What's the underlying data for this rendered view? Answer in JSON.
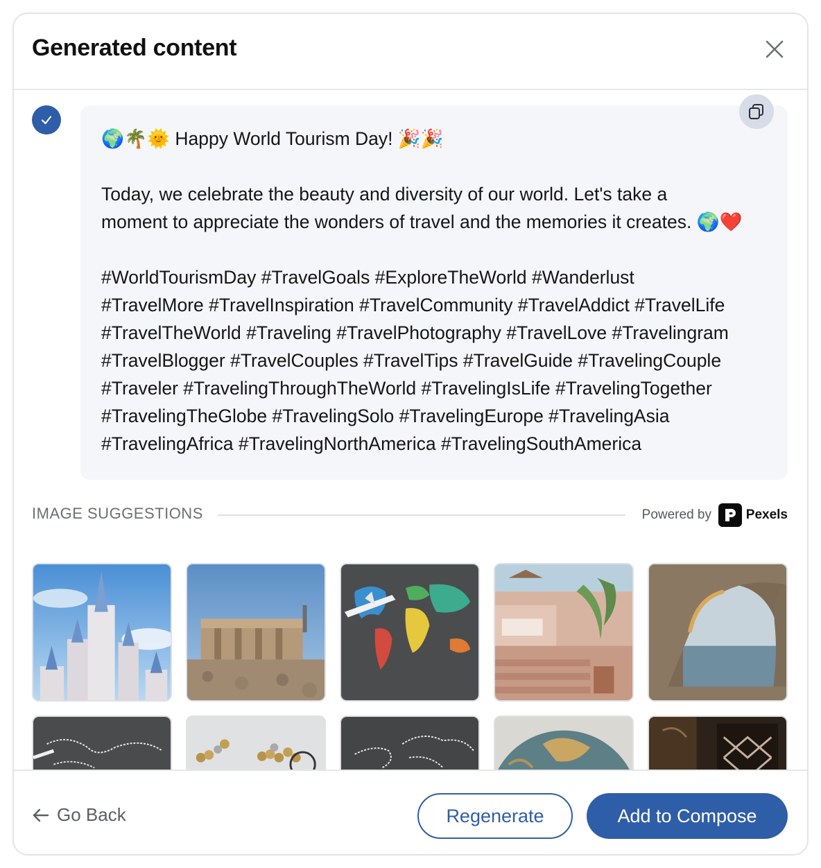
{
  "dialog": {
    "title": "Generated content",
    "close_icon": "close-icon"
  },
  "generated": {
    "selected": true,
    "text": "🌍🌴🌞 Happy World Tourism Day! 🎉🎉\n\nToday, we celebrate the beauty and diversity of our world. Let's take a\nmoment to appreciate the wonders of travel and the memories it creates. 🌍❤️\n\n#WorldTourismDay #TravelGoals #ExploreTheWorld #Wanderlust\n#TravelMore #TravelInspiration #TravelCommunity #TravelAddict #TravelLife\n#TravelTheWorld #Traveling #TravelPhotography #TravelLove #Travelingram\n#TravelBlogger #TravelCouples #TravelTips #TravelGuide #TravelingCouple\n#Traveler #TravelingThroughTheWorld #TravelingIsLife #TravelingTogether\n#TravelingTheGlobe #TravelingSolo #TravelingEurope #TravelingAsia\n#TravelingAfrica #TravelingNorthAmerica #TravelingSouthAmerica",
    "copy_icon": "copy-icon"
  },
  "image_suggestions": {
    "label": "IMAGE SUGGESTIONS",
    "powered_by": "Powered by",
    "provider": "Pexels",
    "images": [
      {
        "subject": "castle"
      },
      {
        "subject": "ancient-ruins"
      },
      {
        "subject": "colorful-world-map"
      },
      {
        "subject": "terrace-courtyard"
      },
      {
        "subject": "rock-arch-sea"
      },
      {
        "subject": "chalk-world-map"
      },
      {
        "subject": "coins"
      },
      {
        "subject": "chalk-world-map-2"
      },
      {
        "subject": "globe"
      },
      {
        "subject": "ornate-window"
      }
    ]
  },
  "footer": {
    "go_back": "Go Back",
    "regenerate": "Regenerate",
    "add_to_compose": "Add to Compose"
  },
  "colors": {
    "accent": "#2f5ea8",
    "card_bg": "#f5f6f9",
    "border": "#e3e4e8"
  }
}
